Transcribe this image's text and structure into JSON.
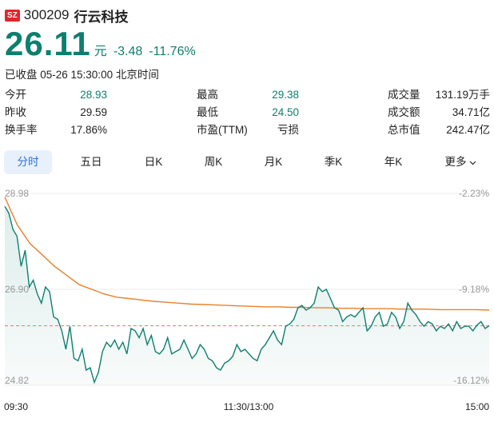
{
  "header": {
    "market_badge": "SZ",
    "code": "300209",
    "name": "行云科技"
  },
  "quote": {
    "price": "26.11",
    "unit": "元",
    "change": "-3.48",
    "change_pct": "-11.76%",
    "status": "已收盘 05-26 15:30:00 北京时间"
  },
  "stats": [
    {
      "label": "今开",
      "value": "28.93"
    },
    {
      "label": "最高",
      "value": "29.38"
    },
    {
      "label": "成交量",
      "value": "131.19万手"
    },
    {
      "label": "昨收",
      "value": "29.59"
    },
    {
      "label": "最低",
      "value": "24.50"
    },
    {
      "label": "成交额",
      "value": "34.71亿"
    },
    {
      "label": "换手率",
      "value": "17.86%"
    },
    {
      "label": "市盈(TTM)",
      "value": "亏损"
    },
    {
      "label": "总市值",
      "value": "242.47亿"
    }
  ],
  "tabs": [
    "分时",
    "五日",
    "日K",
    "周K",
    "月K",
    "季K",
    "年K",
    "更多"
  ],
  "active_tab": "分时",
  "colors": {
    "down": "#0d7f6e",
    "avg_line": "#e8812b",
    "prev_close_line": "#e07878",
    "active_tab_bg": "#e8f0fb",
    "badge": "#e0262b"
  },
  "chart_data": {
    "type": "line",
    "y_left_ticks": [
      "28.98",
      "26.90",
      "24.82"
    ],
    "y_right_ticks": [
      "-2.23%",
      "-9.18%",
      "-16.12%"
    ],
    "x_ticks": [
      "09:30",
      "11:30/13:00",
      "15:00"
    ],
    "ylim": [
      24.82,
      28.98
    ],
    "prev_close_ref": 26.11,
    "series": [
      {
        "values": [
          28.7,
          28.55,
          28.2,
          28.05,
          27.4,
          27.75,
          26.95,
          27.1,
          26.8,
          26.6,
          26.95,
          26.85,
          26.3,
          26.25,
          26.0,
          25.6,
          26.1,
          25.4,
          25.35,
          25.6,
          25.15,
          25.2,
          24.88,
          25.1,
          25.55,
          25.75,
          25.65,
          25.8,
          25.6,
          25.75,
          25.5,
          26.05,
          26.0,
          25.85,
          26.05,
          25.7,
          25.9,
          25.55,
          25.5,
          25.6,
          25.85,
          25.5,
          25.55,
          25.6,
          25.8,
          25.6,
          25.4,
          25.5,
          25.7,
          25.6,
          25.4,
          25.35,
          25.2,
          25.15,
          25.3,
          25.35,
          25.45,
          25.7,
          25.55,
          25.6,
          25.5,
          25.4,
          25.35,
          25.6,
          25.7,
          25.85,
          26.0,
          25.8,
          25.7,
          26.1,
          26.15,
          26.25,
          26.5,
          26.55,
          26.45,
          26.5,
          26.6,
          26.95,
          26.85,
          26.9,
          26.7,
          26.5,
          26.45,
          26.2,
          26.3,
          26.35,
          26.3,
          26.4,
          26.5,
          26.0,
          26.1,
          26.3,
          26.4,
          26.1,
          26.15,
          26.4,
          26.3,
          26.05,
          26.2,
          26.6,
          26.45,
          26.35,
          26.2,
          26.1,
          26.2,
          26.15,
          26.0,
          26.1,
          26.05,
          26.15,
          26.0,
          26.2,
          26.05,
          26.1,
          26.1,
          26.0,
          26.12,
          26.2,
          26.05,
          26.11
        ]
      },
      {
        "values": [
          28.9,
          28.3,
          27.9,
          27.65,
          27.4,
          27.2,
          27.0,
          26.9,
          26.8,
          26.73,
          26.7,
          26.67,
          26.64,
          26.62,
          26.6,
          26.58,
          26.57,
          26.56,
          26.55,
          26.54,
          26.53,
          26.52,
          26.52,
          26.51,
          26.51,
          26.5,
          26.5,
          26.49,
          26.49,
          26.48,
          26.48,
          26.48,
          26.47,
          26.47,
          26.47,
          26.46,
          26.46,
          26.46,
          26.46,
          26.45
        ]
      }
    ]
  }
}
